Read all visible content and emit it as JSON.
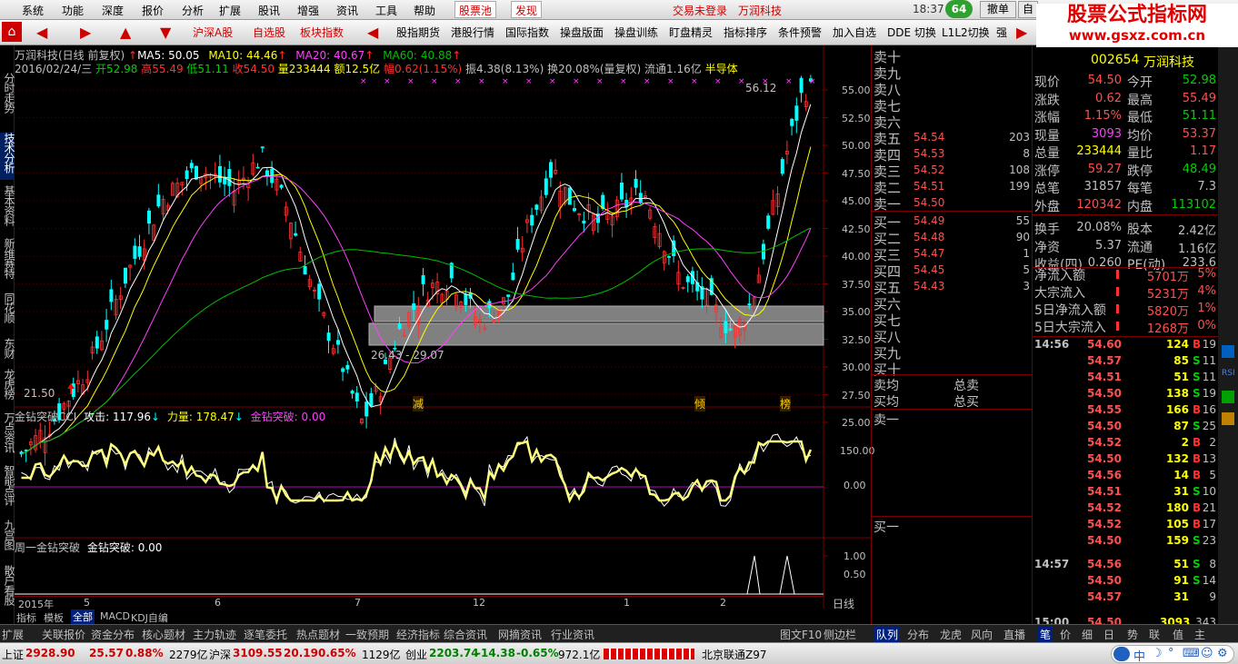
{
  "menu": [
    "系统",
    "功能",
    "深度",
    "报价",
    "分析",
    "扩展",
    "股讯",
    "增强",
    "资讯",
    "工具",
    "帮助"
  ],
  "menu_special": {
    "pool": "股票池",
    "find": "发现"
  },
  "header_notice": "交易未登录",
  "header_stock": "万润科技",
  "clock": "18:37",
  "badge": "64",
  "window_btns": {
    "order": "撤单",
    "self": "自"
  },
  "watermark": {
    "title": "股票公式指标网",
    "url": "www.gsxz.com.cn"
  },
  "toolbar": {
    "items": [
      "沪深A股",
      "自选股",
      "板块指数",
      "股指期货",
      "港股行情",
      "国际指数",
      "操盘版面",
      "操盘训练",
      "盯盘精灵",
      "指标排序",
      "条件预警",
      "加入自选",
      "DDE 切换",
      "L1L2切换",
      "强"
    ]
  },
  "side_tabs": [
    "分时走势",
    "技术分析",
    "基本资料",
    "新维赛特",
    "同花顺",
    "东财",
    "龙虎榜",
    "万点资讯",
    "智能点评",
    "九宫图",
    "散户看股"
  ],
  "kline": {
    "title": "万润科技(日线 前复权)",
    "ma5": "MA5: 50.05",
    "ma10": "MA10: 44.46",
    "ma20": "MA20: 40.67",
    "ma60": "MA60: 40.88",
    "date": "2016/02/24/三",
    "open": "开52.98",
    "high": "高55.49",
    "low": "低51.11",
    "close": "收54.50",
    "vol": "量233444",
    "amt": "额12.5亿",
    "chg": "幅0.62(1.15%)",
    "amp": "振4.38(8.13%)",
    "turn": "换20.08%(量复权)",
    "float": "流通1.16亿",
    "sector": "半导体",
    "max_label": "56.12",
    "min_label": "21.50",
    "range_label": "26.43 - 29.07",
    "y_ticks": [
      "55.00",
      "52.50",
      "50.00",
      "47.50",
      "45.00",
      "42.50",
      "40.00",
      "37.50",
      "35.00",
      "32.50",
      "30.00",
      "27.50",
      "25.00"
    ],
    "markers": [
      "减",
      "倾",
      "榜"
    ]
  },
  "cci": {
    "title": "金钻突破CCI",
    "attack": "攻击: 117.96",
    "power": "力量: 178.47",
    "break": "金钻突破: 0.00",
    "y_ticks": [
      "150.00",
      "0.00"
    ]
  },
  "weekly": {
    "title": "周一金钻突破",
    "value": "金钻突破: 0.00",
    "y_ticks": [
      "1.00",
      "0.50"
    ]
  },
  "x_axis": {
    "labels": [
      "2015年",
      "5",
      "6",
      "7",
      "12",
      "1",
      "2"
    ],
    "period": "日线"
  },
  "chart_tabs": [
    "指标",
    "模板",
    "全部",
    "MACD",
    "KDJ自编"
  ],
  "order_book": {
    "sell": [
      {
        "l": "卖十",
        "p": "",
        "v": ""
      },
      {
        "l": "卖九",
        "p": "",
        "v": ""
      },
      {
        "l": "卖八",
        "p": "",
        "v": ""
      },
      {
        "l": "卖七",
        "p": "",
        "v": ""
      },
      {
        "l": "卖六",
        "p": "",
        "v": ""
      },
      {
        "l": "卖五",
        "p": "54.54",
        "v": "203"
      },
      {
        "l": "卖四",
        "p": "54.53",
        "v": "8"
      },
      {
        "l": "卖三",
        "p": "54.52",
        "v": "108"
      },
      {
        "l": "卖二",
        "p": "54.51",
        "v": "199"
      },
      {
        "l": "卖一",
        "p": "54.50",
        "v": ""
      }
    ],
    "buy": [
      {
        "l": "买一",
        "p": "54.49",
        "v": "55"
      },
      {
        "l": "买二",
        "p": "54.48",
        "v": "90"
      },
      {
        "l": "买三",
        "p": "54.47",
        "v": "1"
      },
      {
        "l": "买四",
        "p": "54.45",
        "v": "5"
      },
      {
        "l": "买五",
        "p": "54.43",
        "v": "3"
      },
      {
        "l": "买六",
        "p": "",
        "v": ""
      },
      {
        "l": "买七",
        "p": "",
        "v": ""
      },
      {
        "l": "买八",
        "p": "",
        "v": ""
      },
      {
        "l": "买九",
        "p": "",
        "v": ""
      },
      {
        "l": "买十",
        "p": "",
        "v": ""
      }
    ],
    "avg_sell": "卖均",
    "total_sell": "总卖",
    "avg_buy": "买均",
    "total_buy": "总买",
    "sell1": "卖一",
    "buy1": "买一"
  },
  "stock_info": {
    "code": "002654",
    "name": "万润科技",
    "rows": [
      {
        "a": "现价",
        "av": "54.50",
        "b": "今开",
        "bv": "52.98"
      },
      {
        "a": "涨跌",
        "av": "0.62",
        "b": "最高",
        "bv": "55.49"
      },
      {
        "a": "涨幅",
        "av": "1.15%",
        "b": "最低",
        "bv": "51.11"
      },
      {
        "a": "现量",
        "av": "3093",
        "b": "均价",
        "bv": "53.37"
      },
      {
        "a": "总量",
        "av": "233444",
        "b": "量比",
        "bv": "1.17"
      },
      {
        "a": "涨停",
        "av": "59.27",
        "b": "跌停",
        "bv": "48.49"
      },
      {
        "a": "总笔",
        "av": "31857",
        "b": "每笔",
        "bv": "7.3"
      },
      {
        "a": "外盘",
        "av": "120342",
        "b": "内盘",
        "bv": "113102"
      },
      {
        "a": "换手",
        "av": "20.08%",
        "b": "股本",
        "bv": "2.42亿"
      },
      {
        "a": "净资",
        "av": "5.37",
        "b": "流通",
        "bv": "1.16亿"
      },
      {
        "a": "收益(四)",
        "av": "0.260",
        "b": "PE(动)",
        "bv": "233.6"
      }
    ],
    "flows": [
      {
        "l": "净流入额",
        "v": "5701万",
        "p": "5%"
      },
      {
        "l": "大宗流入",
        "v": "5231万",
        "p": "4%"
      },
      {
        "l": "5日净流入额",
        "v": "5820万",
        "p": "1%"
      },
      {
        "l": "5日大宗流入",
        "v": "1268万",
        "p": "0%"
      }
    ],
    "ticks": [
      {
        "t": "14:56",
        "p": "54.60",
        "v": "124",
        "s": "B",
        "n": "19"
      },
      {
        "t": "",
        "p": "54.57",
        "v": "85",
        "s": "S",
        "n": "11"
      },
      {
        "t": "",
        "p": "54.51",
        "v": "51",
        "s": "S",
        "n": "11"
      },
      {
        "t": "",
        "p": "54.50",
        "v": "138",
        "s": "S",
        "n": "19"
      },
      {
        "t": "",
        "p": "54.55",
        "v": "166",
        "s": "B",
        "n": "16"
      },
      {
        "t": "",
        "p": "54.50",
        "v": "87",
        "s": "S",
        "n": "25"
      },
      {
        "t": "",
        "p": "54.52",
        "v": "2",
        "s": "B",
        "n": "2"
      },
      {
        "t": "",
        "p": "54.50",
        "v": "132",
        "s": "B",
        "n": "13"
      },
      {
        "t": "",
        "p": "54.56",
        "v": "14",
        "s": "B",
        "n": "5"
      },
      {
        "t": "",
        "p": "54.51",
        "v": "31",
        "s": "S",
        "n": "10"
      },
      {
        "t": "",
        "p": "54.52",
        "v": "180",
        "s": "B",
        "n": "21"
      },
      {
        "t": "",
        "p": "54.52",
        "v": "105",
        "s": "B",
        "n": "17"
      },
      {
        "t": "",
        "p": "54.50",
        "v": "159",
        "s": "S",
        "n": "23"
      },
      {
        "t": "14:57",
        "p": "54.56",
        "v": "51",
        "s": "S",
        "n": "8"
      },
      {
        "t": "",
        "p": "54.50",
        "v": "91",
        "s": "S",
        "n": "14"
      },
      {
        "t": "",
        "p": "54.57",
        "v": "31",
        "s": "",
        "n": "9"
      },
      {
        "t": "15:00",
        "p": "54.50",
        "v": "3093",
        "s": "",
        "n": "343"
      }
    ]
  },
  "bottom_tabs": [
    "扩展",
    "关联报价",
    "资金分布",
    "核心题材",
    "主力轨迹",
    "逐笔委托",
    "热点题材",
    "一致预期",
    "经济指标",
    "综合资讯",
    "网摘资讯",
    "行业资讯",
    "图文F10",
    "侧边栏"
  ],
  "right_tabs": [
    "队列",
    "分布",
    "龙虎",
    "风向",
    "直播",
    "笔",
    "价",
    "细",
    "日",
    "势",
    "联",
    "值",
    "主"
  ],
  "status": {
    "sh": "上证",
    "sh_v": "2928.90",
    "sh_c": "25.57",
    "sh_p": "0.88%",
    "sh_amt": "2279亿",
    "hs": "沪深",
    "hs_v": "3109.55",
    "hs_c": "20.19",
    "hs_p": "0.65%",
    "hs_amt": "1129亿",
    "cy": "创业",
    "cy_v": "2203.74",
    "cy_c": "-14.38",
    "cy_p": "-0.65%",
    "cy_amt": "972.1亿",
    "server": "北京联通Z97"
  },
  "colors": {
    "up": "#ff3030",
    "down": "#00ffff",
    "ma5": "#ffffff",
    "ma10": "#ffff00",
    "ma20": "#ff40ff",
    "ma60": "#00c000"
  }
}
